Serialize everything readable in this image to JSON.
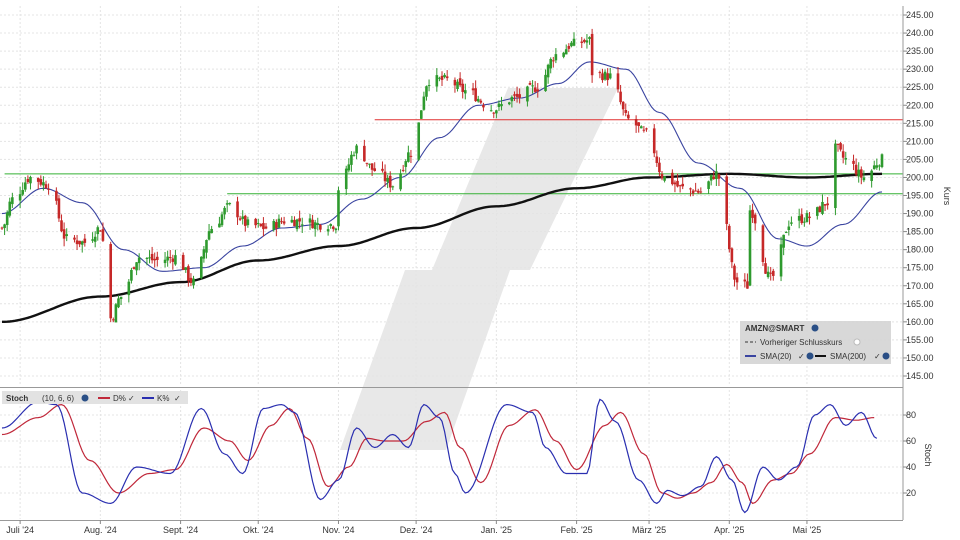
{
  "chart_data": {
    "type": "candlestick",
    "symbol": "AMZN@SMART",
    "price_axis_label": "Kurs",
    "price_ylim": [
      140,
      250
    ],
    "price_ticks": [
      "245.00",
      "240.00",
      "235.00",
      "230.00",
      "225.00",
      "220.00",
      "215.00",
      "210.00",
      "205.00",
      "200.00",
      "195.00",
      "190.00",
      "185.00",
      "180.00",
      "175.00",
      "170.00",
      "165.00",
      "160.00",
      "155.00",
      "150.00",
      "145.00"
    ],
    "x_labels": [
      "Juli '24",
      "Aug. '24",
      "Sept. '24",
      "Okt. '24",
      "Nov. '24",
      "Dez. '24",
      "Jan. '25",
      "Feb. '25",
      "März '25",
      "Apr. '25",
      "Mai '25"
    ],
    "x_label_dates": [
      "2024-07-01",
      "2024-08-01",
      "2024-09-01",
      "2024-10-01",
      "2024-11-01",
      "2024-12-01",
      "2025-01-01",
      "2025-02-01",
      "2025-03-01",
      "2025-04-01",
      "2025-05-01"
    ],
    "date_range": [
      "2024-06-24",
      "2025-05-30"
    ],
    "horizontal_lines": [
      {
        "value": 216,
        "color": "#e03030",
        "from": "2024-11-15"
      },
      {
        "value": 201,
        "color": "#35b035",
        "from": "2024-06-25"
      },
      {
        "value": 195.5,
        "color": "#35b035",
        "from": "2024-09-19"
      }
    ],
    "close_anchors": [
      [
        "2024-06-24",
        186
      ],
      [
        "2024-06-28",
        194
      ],
      [
        "2024-07-05",
        200
      ],
      [
        "2024-07-12",
        198
      ],
      [
        "2024-07-19",
        183
      ],
      [
        "2024-07-26",
        182
      ],
      [
        "2024-08-01",
        186
      ],
      [
        "2024-08-05",
        161
      ],
      [
        "2024-08-09",
        167
      ],
      [
        "2024-08-16",
        178
      ],
      [
        "2024-08-23",
        177
      ],
      [
        "2024-08-30",
        178
      ],
      [
        "2024-09-06",
        171
      ],
      [
        "2024-09-13",
        186
      ],
      [
        "2024-09-20",
        192
      ],
      [
        "2024-09-27",
        187
      ],
      [
        "2024-10-04",
        186
      ],
      [
        "2024-10-11",
        188
      ],
      [
        "2024-10-18",
        188
      ],
      [
        "2024-10-25",
        187
      ],
      [
        "2024-10-31",
        187
      ],
      [
        "2024-11-01",
        197
      ],
      [
        "2024-11-08",
        208
      ],
      [
        "2024-11-15",
        202
      ],
      [
        "2024-11-22",
        198
      ],
      [
        "2024-11-29",
        207
      ],
      [
        "2024-12-06",
        227
      ],
      [
        "2024-12-13",
        227
      ],
      [
        "2024-12-20",
        224
      ],
      [
        "2024-12-31",
        219
      ],
      [
        "2025-01-08",
        222
      ],
      [
        "2025-01-17",
        225
      ],
      [
        "2025-01-24",
        234
      ],
      [
        "2025-01-31",
        237
      ],
      [
        "2025-02-06",
        238
      ],
      [
        "2025-02-07",
        229
      ],
      [
        "2025-02-14",
        228
      ],
      [
        "2025-02-21",
        216
      ],
      [
        "2025-02-28",
        212
      ],
      [
        "2025-03-07",
        200
      ],
      [
        "2025-03-14",
        197
      ],
      [
        "2025-03-21",
        196
      ],
      [
        "2025-03-27",
        201
      ],
      [
        "2025-04-04",
        171
      ],
      [
        "2025-04-08",
        170
      ],
      [
        "2025-04-09",
        191
      ],
      [
        "2025-04-17",
        172
      ],
      [
        "2025-04-25",
        188
      ],
      [
        "2025-05-02",
        189
      ],
      [
        "2025-05-09",
        193
      ],
      [
        "2025-05-12",
        208
      ],
      [
        "2025-05-16",
        205
      ],
      [
        "2025-05-23",
        200
      ],
      [
        "2025-05-30",
        205
      ]
    ],
    "sma_series": [
      {
        "name": "SMA(20)",
        "color": "#3a44a0",
        "anchors": [
          [
            "2024-06-24",
            190
          ],
          [
            "2024-07-10",
            197
          ],
          [
            "2024-07-25",
            193
          ],
          [
            "2024-08-10",
            180
          ],
          [
            "2024-08-25",
            174
          ],
          [
            "2024-09-10",
            175
          ],
          [
            "2024-09-25",
            181
          ],
          [
            "2024-10-10",
            186
          ],
          [
            "2024-10-25",
            187
          ],
          [
            "2024-11-10",
            194
          ],
          [
            "2024-11-25",
            200
          ],
          [
            "2024-12-10",
            211
          ],
          [
            "2024-12-25",
            220
          ],
          [
            "2025-01-10",
            222
          ],
          [
            "2025-01-25",
            226
          ],
          [
            "2025-02-06",
            232
          ],
          [
            "2025-02-20",
            230
          ],
          [
            "2025-03-05",
            218
          ],
          [
            "2025-03-20",
            204
          ],
          [
            "2025-04-05",
            197
          ],
          [
            "2025-04-20",
            183
          ],
          [
            "2025-05-01",
            181
          ],
          [
            "2025-05-15",
            187
          ],
          [
            "2025-05-30",
            196
          ]
        ]
      },
      {
        "name": "SMA(200)",
        "color": "#111111",
        "anchors": [
          [
            "2024-06-24",
            160
          ],
          [
            "2024-08-01",
            167
          ],
          [
            "2024-09-01",
            171
          ],
          [
            "2024-10-01",
            177
          ],
          [
            "2024-11-01",
            181
          ],
          [
            "2024-12-01",
            186
          ],
          [
            "2025-01-01",
            192
          ],
          [
            "2025-02-01",
            197
          ],
          [
            "2025-03-01",
            200
          ],
          [
            "2025-04-01",
            201
          ],
          [
            "2025-05-01",
            200
          ],
          [
            "2025-05-30",
            201
          ]
        ]
      }
    ],
    "legend": {
      "title": "AMZN@SMART",
      "items": [
        "Vorheriger Schlusskurs",
        "SMA(20)",
        "SMA(200)"
      ]
    },
    "stoch": {
      "label": "Stoch",
      "params": "(10, 6, 6)",
      "legend_d": "D%",
      "legend_k": "K%",
      "axis_label": "Stoch",
      "ylim": [
        0,
        100
      ],
      "ticks": [
        "80",
        "60",
        "40",
        "20"
      ],
      "k_color": "#2a2fb0",
      "d_color": "#c0283a",
      "k_anchors": [
        [
          "2024-06-24",
          70
        ],
        [
          "2024-07-08",
          90
        ],
        [
          "2024-07-15",
          88
        ],
        [
          "2024-07-25",
          20
        ],
        [
          "2024-08-05",
          12
        ],
        [
          "2024-08-15",
          40
        ],
        [
          "2024-08-28",
          35
        ],
        [
          "2024-09-09",
          85
        ],
        [
          "2024-09-18",
          50
        ],
        [
          "2024-09-25",
          35
        ],
        [
          "2024-10-03",
          85
        ],
        [
          "2024-10-10",
          88
        ],
        [
          "2024-10-15",
          82
        ],
        [
          "2024-10-25",
          15
        ],
        [
          "2024-11-01",
          30
        ],
        [
          "2024-11-08",
          70
        ],
        [
          "2024-11-15",
          55
        ],
        [
          "2024-11-22",
          65
        ],
        [
          "2024-11-28",
          55
        ],
        [
          "2024-12-04",
          88
        ],
        [
          "2024-12-10",
          78
        ],
        [
          "2024-12-16",
          35
        ],
        [
          "2024-12-20",
          20
        ],
        [
          "2025-01-05",
          88
        ],
        [
          "2025-01-15",
          82
        ],
        [
          "2025-01-20",
          55
        ],
        [
          "2025-01-28",
          35
        ],
        [
          "2025-02-05",
          35
        ],
        [
          "2025-02-10",
          92
        ],
        [
          "2025-02-16",
          75
        ],
        [
          "2025-02-25",
          30
        ],
        [
          "2025-03-04",
          12
        ],
        [
          "2025-03-08",
          22
        ],
        [
          "2025-03-14",
          18
        ],
        [
          "2025-03-21",
          25
        ],
        [
          "2025-03-27",
          48
        ],
        [
          "2025-04-02",
          30
        ],
        [
          "2025-04-07",
          5
        ],
        [
          "2025-04-14",
          40
        ],
        [
          "2025-04-20",
          30
        ],
        [
          "2025-04-27",
          40
        ],
        [
          "2025-05-04",
          80
        ],
        [
          "2025-05-10",
          88
        ],
        [
          "2025-05-16",
          72
        ],
        [
          "2025-05-22",
          82
        ],
        [
          "2025-05-28",
          62
        ]
      ],
      "d_anchors": [
        [
          "2024-06-24",
          65
        ],
        [
          "2024-07-08",
          78
        ],
        [
          "2024-07-17",
          88
        ],
        [
          "2024-07-28",
          45
        ],
        [
          "2024-08-08",
          20
        ],
        [
          "2024-08-20",
          35
        ],
        [
          "2024-08-30",
          38
        ],
        [
          "2024-09-10",
          70
        ],
        [
          "2024-09-20",
          60
        ],
        [
          "2024-09-27",
          45
        ],
        [
          "2024-10-06",
          72
        ],
        [
          "2024-10-13",
          85
        ],
        [
          "2024-10-20",
          62
        ],
        [
          "2024-10-28",
          25
        ],
        [
          "2024-11-05",
          40
        ],
        [
          "2024-11-12",
          62
        ],
        [
          "2024-11-19",
          60
        ],
        [
          "2024-11-26",
          60
        ],
        [
          "2024-12-05",
          75
        ],
        [
          "2024-12-12",
          82
        ],
        [
          "2024-12-18",
          55
        ],
        [
          "2024-12-26",
          28
        ],
        [
          "2025-01-06",
          72
        ],
        [
          "2025-01-16",
          84
        ],
        [
          "2025-01-24",
          60
        ],
        [
          "2025-02-01",
          38
        ],
        [
          "2025-02-12",
          72
        ],
        [
          "2025-02-18",
          82
        ],
        [
          "2025-02-27",
          50
        ],
        [
          "2025-03-06",
          20
        ],
        [
          "2025-03-12",
          16
        ],
        [
          "2025-03-18",
          20
        ],
        [
          "2025-03-25",
          28
        ],
        [
          "2025-03-31",
          42
        ],
        [
          "2025-04-06",
          28
        ],
        [
          "2025-04-10",
          12
        ],
        [
          "2025-04-18",
          30
        ],
        [
          "2025-04-25",
          35
        ],
        [
          "2025-05-02",
          50
        ],
        [
          "2025-05-12",
          78
        ],
        [
          "2025-05-20",
          76
        ],
        [
          "2025-05-27",
          78
        ]
      ]
    },
    "watermark": "stylized-logo"
  }
}
